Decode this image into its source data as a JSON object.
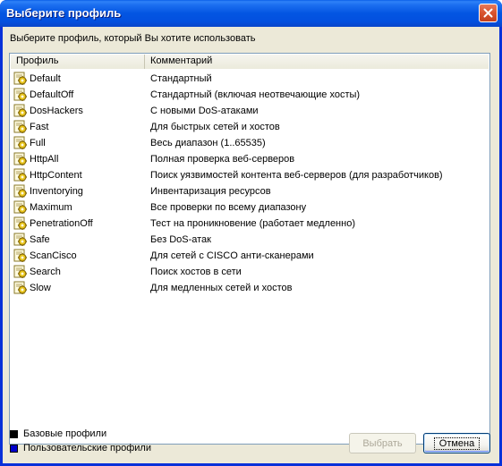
{
  "window": {
    "title": "Выберите профиль",
    "instruction": "Выберите профиль, который Вы хотите использовать"
  },
  "list": {
    "columns": [
      "Профиль",
      "Комментарий"
    ],
    "rows": [
      {
        "name": "Default",
        "comment": "Стандартный"
      },
      {
        "name": "DefaultOff",
        "comment": "Стандартный (включая неотвечающие хосты)"
      },
      {
        "name": "DosHackers",
        "comment": "С новыми DoS-атаками"
      },
      {
        "name": "Fast",
        "comment": "Для быстрых сетей и хостов"
      },
      {
        "name": "Full",
        "comment": "Весь диапазон (1..65535)"
      },
      {
        "name": "HttpAll",
        "comment": "Полная проверка веб-серверов"
      },
      {
        "name": "HttpContent",
        "comment": "Поиск уязвимостей контента веб-серверов (для разработчиков)"
      },
      {
        "name": "Inventorying",
        "comment": "Инвентаризация ресурсов"
      },
      {
        "name": "Maximum",
        "comment": "Все проверки по всему диапазону"
      },
      {
        "name": "PenetrationOff",
        "comment": "Тест на проникновение (работает медленно)"
      },
      {
        "name": "Safe",
        "comment": "Без DoS-атак"
      },
      {
        "name": "ScanCisco",
        "comment": "Для сетей с CISCO анти-сканерами"
      },
      {
        "name": "Search",
        "comment": "Поиск хостов в сети"
      },
      {
        "name": "Slow",
        "comment": "Для медленных сетей и хостов"
      }
    ],
    "row_icon": "profile-gear-icon"
  },
  "legend": {
    "base_label": "Базовые профили",
    "base_color": "#000000",
    "user_label": "Пользовательские профили",
    "user_color": "#0000cc"
  },
  "buttons": {
    "select_label": "Выбрать",
    "cancel_label": "Отмена"
  },
  "colors": {
    "title_bar": "#0355e2",
    "dialog_bg": "#ece9d8",
    "close_button": "#d8532e"
  }
}
